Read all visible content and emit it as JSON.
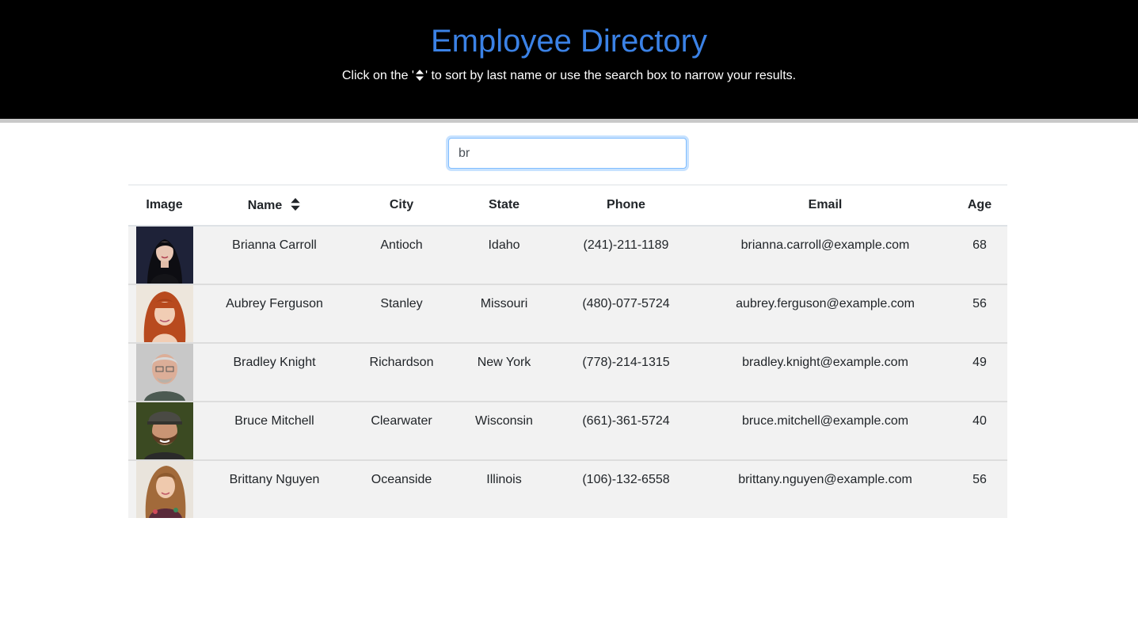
{
  "header": {
    "title": "Employee Directory",
    "subtitle_before": "Click on the '",
    "subtitle_after": "' to sort by last name or use the search box to narrow your results."
  },
  "colors": {
    "header_bg": "#000000",
    "title": "#3b82e6",
    "row_bg": "#f2f2f2"
  },
  "search": {
    "value": "br",
    "placeholder": ""
  },
  "table": {
    "columns": [
      "Image",
      "Name",
      "City",
      "State",
      "Phone",
      "Email",
      "Age"
    ],
    "sort_icon": "sort-icon",
    "rows": [
      {
        "name": "Brianna Carroll",
        "city": "Antioch",
        "state": "Idaho",
        "phone": "(241)-211-1189",
        "email": "brianna.carroll@example.com",
        "age": "68"
      },
      {
        "name": "Aubrey Ferguson",
        "city": "Stanley",
        "state": "Missouri",
        "phone": "(480)-077-5724",
        "email": "aubrey.ferguson@example.com",
        "age": "56"
      },
      {
        "name": "Bradley Knight",
        "city": "Richardson",
        "state": "New York",
        "phone": "(778)-214-1315",
        "email": "bradley.knight@example.com",
        "age": "49"
      },
      {
        "name": "Bruce Mitchell",
        "city": "Clearwater",
        "state": "Wisconsin",
        "phone": "(661)-361-5724",
        "email": "bruce.mitchell@example.com",
        "age": "40"
      },
      {
        "name": "Brittany Nguyen",
        "city": "Oceanside",
        "state": "Illinois",
        "phone": "(106)-132-6558",
        "email": "brittany.nguyen@example.com",
        "age": "56"
      }
    ]
  }
}
